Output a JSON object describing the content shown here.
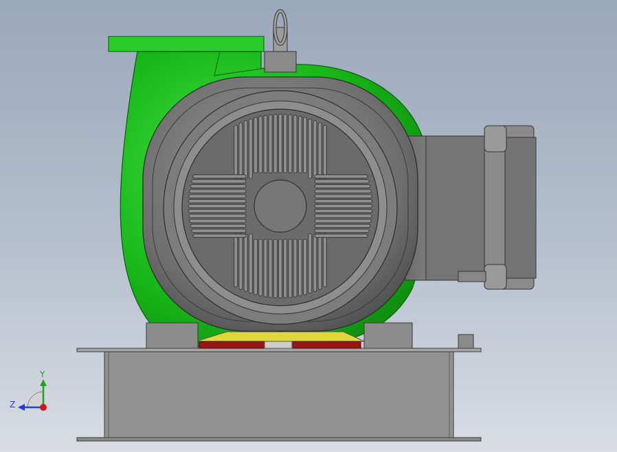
{
  "viewport": {
    "background_top": "#9aa8bb",
    "background_bottom": "#d9dde3"
  },
  "model": {
    "pump_casing_color": "#1fc21f",
    "motor_color": "#7a7a7a",
    "base_color": "#8f8f8f",
    "shim_yellow": "#e0d83a",
    "shim_red": "#9a1515"
  },
  "triad": {
    "y_label": "Y",
    "z_label": "Z",
    "y_color": "#1aa51a",
    "z_color": "#1f3fd6",
    "origin_color": "#d01818"
  }
}
